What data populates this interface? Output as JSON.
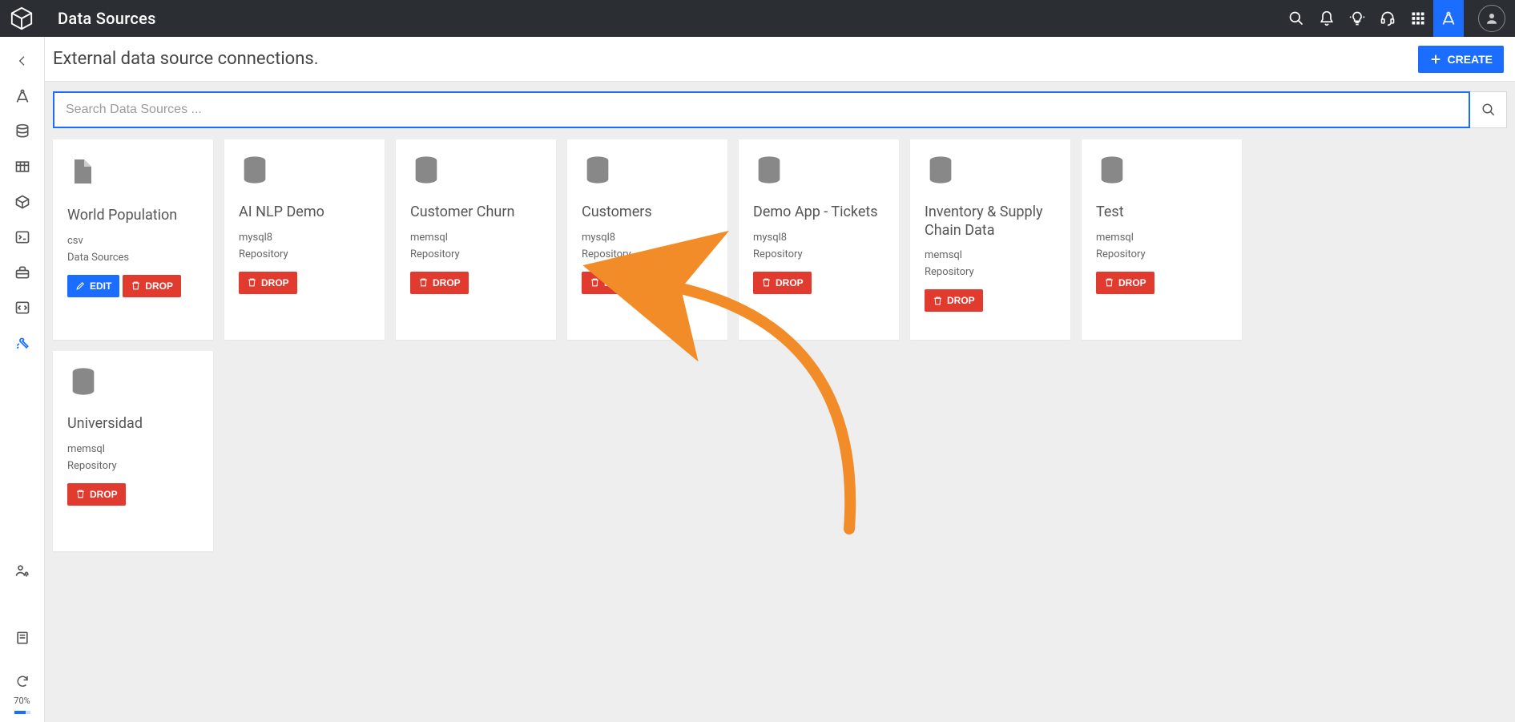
{
  "app": {
    "title": "Data Sources"
  },
  "header": {
    "subtitle": "External data source connections.",
    "create_label": "CREATE"
  },
  "search": {
    "placeholder": "Search Data Sources ..."
  },
  "buttons": {
    "edit": "EDIT",
    "drop": "DROP"
  },
  "footer": {
    "zoom": "70%"
  },
  "cards": [
    {
      "icon": "file",
      "name": "World Population",
      "db": "csv",
      "type": "Data Sources",
      "editable": true
    },
    {
      "icon": "database",
      "name": "AI NLP Demo",
      "db": "mysql8",
      "type": "Repository",
      "editable": false
    },
    {
      "icon": "database",
      "name": "Customer Churn",
      "db": "memsql",
      "type": "Repository",
      "editable": false
    },
    {
      "icon": "database",
      "name": "Customers",
      "db": "mysql8",
      "type": "Repository",
      "editable": false
    },
    {
      "icon": "database",
      "name": "Demo App - Tickets",
      "db": "mysql8",
      "type": "Repository",
      "editable": false
    },
    {
      "icon": "database",
      "name": "Inventory & Supply Chain Data",
      "db": "memsql",
      "type": "Repository",
      "editable": false
    },
    {
      "icon": "database",
      "name": "Test",
      "db": "memsql",
      "type": "Repository",
      "editable": false
    },
    {
      "icon": "database",
      "name": "Universidad",
      "db": "memsql",
      "type": "Repository",
      "editable": false
    }
  ]
}
